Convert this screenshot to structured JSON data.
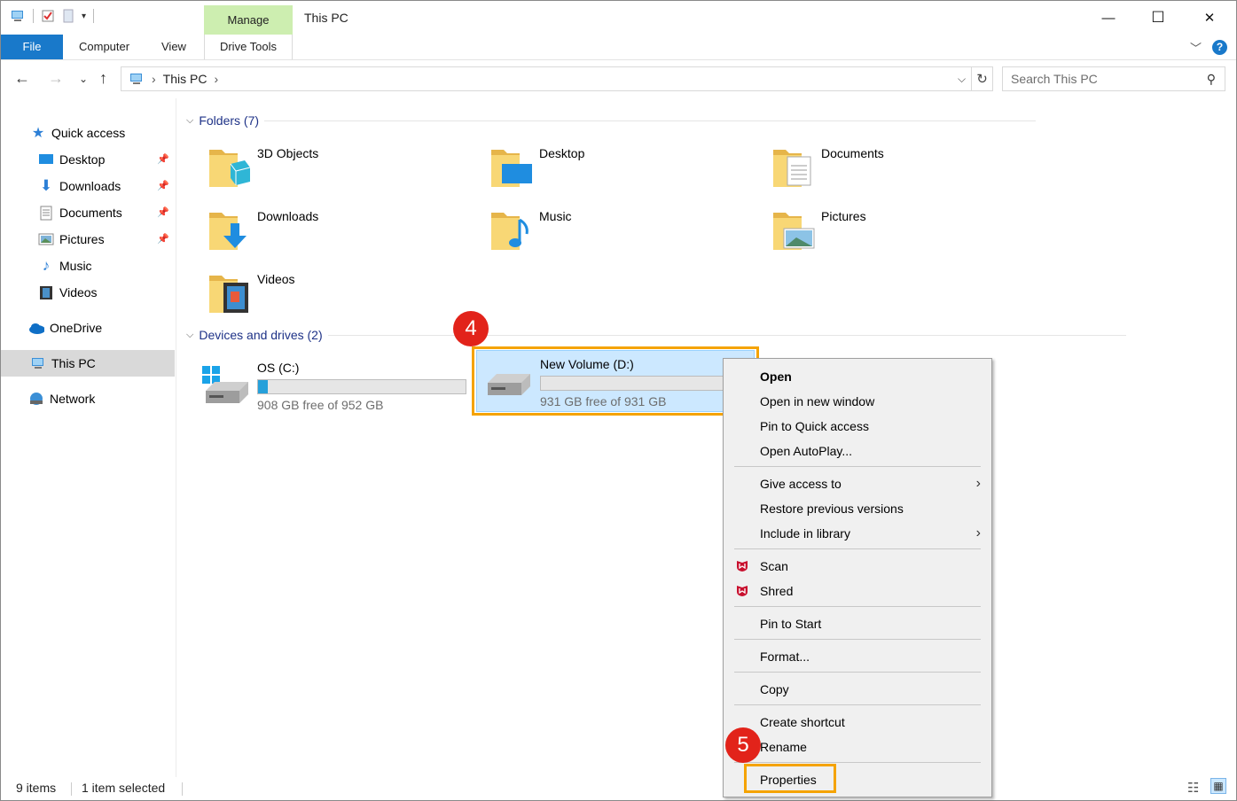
{
  "window": {
    "title": "This PC",
    "manage_tab": "Manage",
    "controls": {
      "minimize": "—",
      "maximize": "☐",
      "close": "✕"
    }
  },
  "ribbon": {
    "tabs": [
      "File",
      "Computer",
      "View",
      "Drive Tools"
    ]
  },
  "address": {
    "path": "This PC",
    "search_placeholder": "Search This PC"
  },
  "nav": {
    "items": [
      {
        "label": "Quick access"
      },
      {
        "label": "Desktop"
      },
      {
        "label": "Downloads"
      },
      {
        "label": "Documents"
      },
      {
        "label": "Pictures"
      },
      {
        "label": "Music"
      },
      {
        "label": "Videos"
      },
      {
        "label": "OneDrive"
      },
      {
        "label": "This PC"
      },
      {
        "label": "Network"
      }
    ]
  },
  "folders": {
    "header": "Folders (7)",
    "items": [
      "3D Objects",
      "Desktop",
      "Documents",
      "Downloads",
      "Music",
      "Pictures",
      "Videos"
    ]
  },
  "drives": {
    "header": "Devices and drives (2)",
    "items": [
      {
        "name": "OS (C:)",
        "free": "908 GB free of 952 GB",
        "used_fraction": 0.046
      },
      {
        "name": "New Volume (D:)",
        "free": "931 GB free of 931 GB",
        "used_fraction": 0.0
      }
    ]
  },
  "badges": {
    "step4": "4",
    "step5": "5"
  },
  "context_menu": {
    "items": [
      "Open",
      "Open in new window",
      "Pin to Quick access",
      "Open AutoPlay...",
      "Give access to",
      "Restore previous versions",
      "Include in library",
      "Scan",
      "Shred",
      "Pin to Start",
      "Format...",
      "Copy",
      "Create shortcut",
      "Rename",
      "Properties"
    ]
  },
  "status": {
    "items_count": "9 items",
    "selected": "1 item selected"
  },
  "colors": {
    "accent": "#1979ca",
    "manage_tab": "#cdeeb0",
    "highlight_box": "#f5a300",
    "badge": "#e2231a",
    "selection": "#cce8ff",
    "group_header": "#1e3287"
  }
}
